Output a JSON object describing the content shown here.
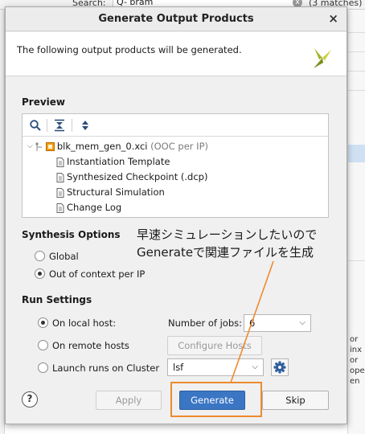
{
  "background": {
    "search_label": "Search:",
    "search_value": "Q- bram",
    "clear_icon": "x",
    "matches_text": "(3 matches)",
    "right_edge_text": [
      "or",
      "inx",
      "or",
      "ope",
      "en"
    ]
  },
  "dialog": {
    "title": "Generate Output Products",
    "close_glyph": "×",
    "header_text": "The following output products will be generated."
  },
  "preview": {
    "section_title": "Preview",
    "toolbar_icons": [
      "search-icon",
      "collapse-all-icon",
      "expand-all-icon"
    ],
    "root": {
      "name": "blk_mem_gen_0.xci",
      "note": "(OOC per IP)"
    },
    "children": [
      "Instantiation Template",
      "Synthesized Checkpoint (.dcp)",
      "Structural Simulation",
      "Change Log"
    ]
  },
  "synthesis": {
    "section_title": "Synthesis Options",
    "options": [
      {
        "label": "Global",
        "selected": false
      },
      {
        "label": "Out of context per IP",
        "selected": true
      }
    ]
  },
  "run_settings": {
    "section_title": "Run Settings",
    "local_host": "On local host:",
    "remote_hosts": "On remote hosts",
    "cluster": "Launch runs on Cluster",
    "selected": "local",
    "jobs_label": "Number of jobs:",
    "jobs_value": "6",
    "configure_hosts": "Configure Hosts",
    "cluster_value": "lsf"
  },
  "buttons": {
    "help": "?",
    "apply": "Apply",
    "generate": "Generate",
    "skip": "Skip"
  },
  "annotation": {
    "line1": "早速シミュレーションしたいので",
    "line2": "Generateで関連ファイルを生成"
  },
  "colors": {
    "accent": "#3b76c4",
    "annotation": "#ee8a2e",
    "logo": "#a6b52a"
  }
}
